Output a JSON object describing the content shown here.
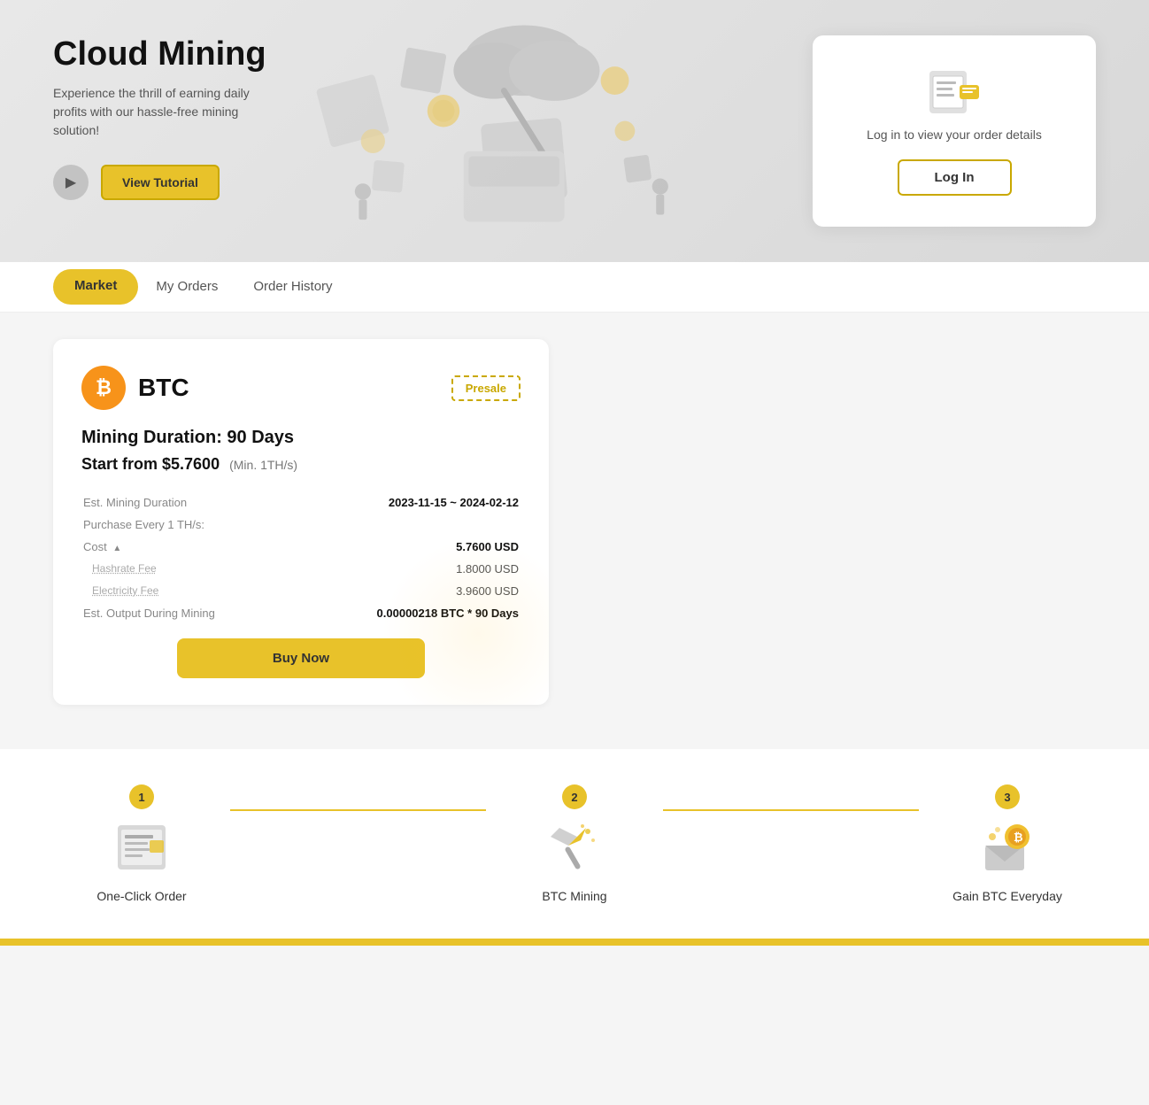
{
  "hero": {
    "title": "Cloud Mining",
    "subtitle": "Experience the thrill of earning daily profits with our hassle-free mining solution!",
    "tutorial_label": "View Tutorial",
    "login_card": {
      "text": "Log in to view your order details",
      "button_label": "Log In"
    }
  },
  "tabs": {
    "items": [
      {
        "id": "market",
        "label": "Market",
        "active": true
      },
      {
        "id": "my-orders",
        "label": "My Orders",
        "active": false
      },
      {
        "id": "order-history",
        "label": "Order History",
        "active": false
      }
    ]
  },
  "mining_card": {
    "coin": "BTC",
    "presale_label": "Presale",
    "duration_label": "Mining Duration: 90 Days",
    "start_from_label": "Start from $5.7600",
    "min_label": "(Min. 1TH/s)",
    "est_duration_label": "Est. Mining Duration",
    "est_duration_value": "2023-11-15 ~ 2024-02-12",
    "purchase_label": "Purchase Every 1 TH/s:",
    "cost_label": "Cost",
    "cost_value": "5.7600 USD",
    "hashrate_label": "Hashrate Fee",
    "hashrate_value": "1.8000 USD",
    "electricity_label": "Electricity Fee",
    "electricity_value": "3.9600 USD",
    "est_output_label": "Est. Output During Mining",
    "est_output_value": "0.00000218 BTC * 90 Days",
    "buy_button_label": "Buy Now"
  },
  "steps": {
    "items": [
      {
        "number": "1",
        "label": "One-Click Order"
      },
      {
        "number": "2",
        "label": "BTC Mining"
      },
      {
        "number": "3",
        "label": "Gain BTC Everyday"
      }
    ]
  }
}
